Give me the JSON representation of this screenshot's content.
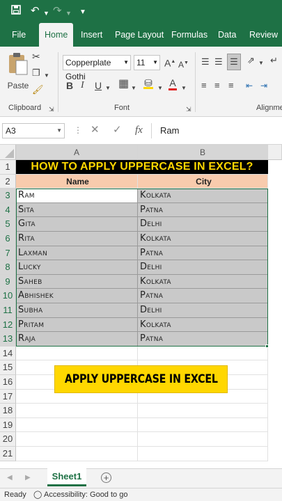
{
  "qat": {
    "save": "save",
    "undo": "undo",
    "redo": "redo",
    "customize": "customize"
  },
  "tabs": [
    "File",
    "Home",
    "Insert",
    "Page Layout",
    "Formulas",
    "Data",
    "Review"
  ],
  "ribbon": {
    "paste_label": "Paste",
    "clipboard_label": "Clipboard",
    "font_name": "Copperplate Gothi",
    "font_size": "11",
    "font_label": "Font",
    "alignment_label": "Alignme"
  },
  "formula_bar": {
    "name_box": "A3",
    "content": "Ram",
    "fx": "fx"
  },
  "grid": {
    "columns": [
      "A",
      "B"
    ],
    "rows": [
      "1",
      "2",
      "3",
      "4",
      "5",
      "6",
      "7",
      "8",
      "9",
      "10",
      "11",
      "12",
      "13",
      "14",
      "15",
      "16",
      "17",
      "18",
      "19",
      "20",
      "21"
    ],
    "title": "HOW TO APPLY UPPERCASE IN EXCEL?",
    "headers": {
      "name": "Name",
      "city": "City"
    },
    "data": [
      [
        "Ram",
        "Kolkata"
      ],
      [
        "Sita",
        "Patna"
      ],
      [
        "Gita",
        "Delhi"
      ],
      [
        "Rita",
        "Kolkata"
      ],
      [
        "Laxman",
        "Patna"
      ],
      [
        "Lucky",
        "Delhi"
      ],
      [
        "Saheb",
        "Kolkata"
      ],
      [
        "Abhishek",
        "Patna"
      ],
      [
        "Subha",
        "Delhi"
      ],
      [
        "Pritam",
        "Kolkata"
      ],
      [
        "Raja",
        "Patna"
      ]
    ],
    "banner": "APPLY UPPERCASE IN EXCEL"
  },
  "sheet": {
    "name": "Sheet1",
    "add": "+"
  },
  "status": {
    "ready": "Ready",
    "accessibility": "Accessibility: Good to go"
  },
  "colors": {
    "brand": "#1e7145",
    "title_bg": "#000000",
    "title_fg": "#ffd700",
    "header_bg": "#f8cbad",
    "selection": "#c9c9c9",
    "banner_bg": "#ffd700"
  }
}
